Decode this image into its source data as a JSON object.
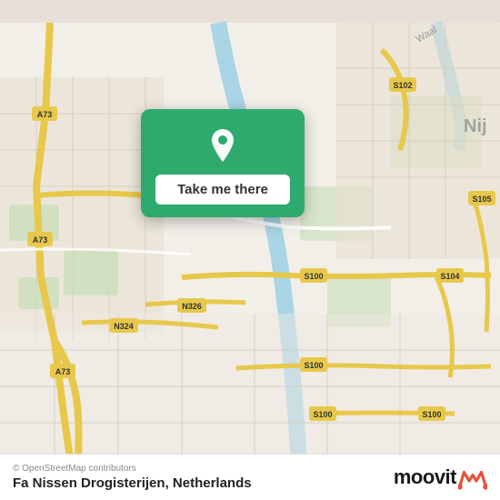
{
  "map": {
    "background_color": "#e8e0d8",
    "center_lat": 51.83,
    "center_lng": 5.83
  },
  "popup": {
    "button_label": "Take me there",
    "pin_color": "#ffffff",
    "background_color": "#2eaa6e"
  },
  "bottom_bar": {
    "attribution": "© OpenStreetMap contributors",
    "location_name": "Fa Nissen Drogisterijen",
    "country": "Netherlands",
    "moovit_label": "moovit"
  }
}
